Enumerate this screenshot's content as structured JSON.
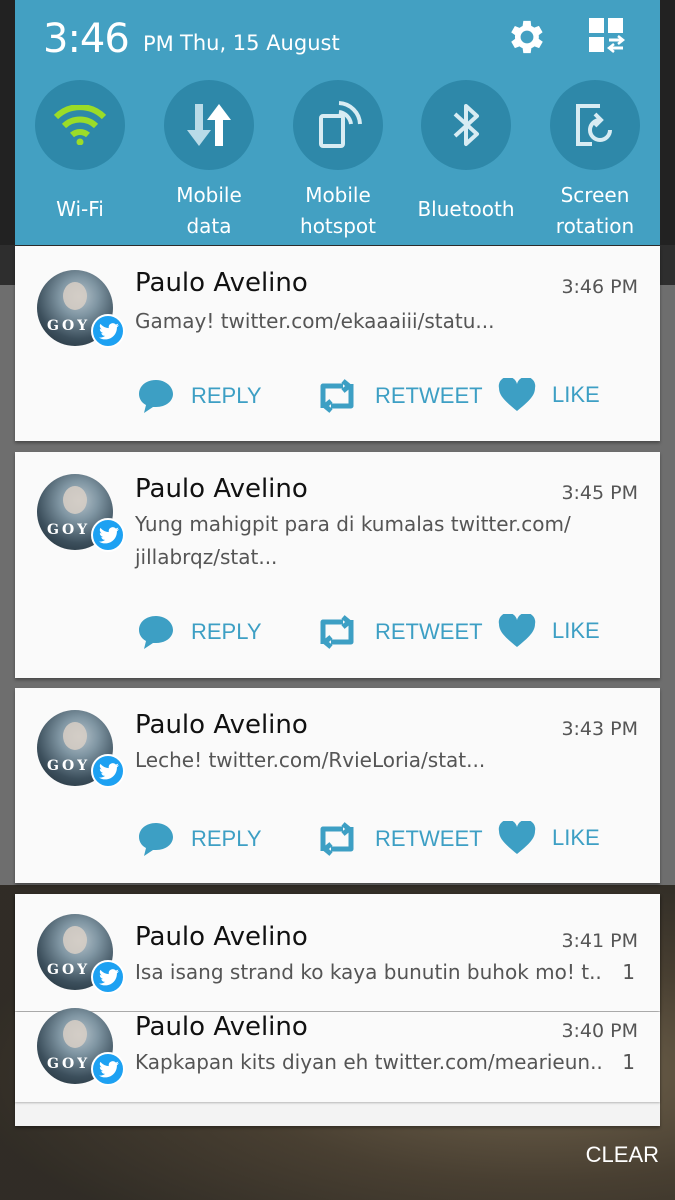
{
  "status": {
    "clock": "3:46",
    "ampm": "PM",
    "date": "Thu, 15 August"
  },
  "icons": {
    "settings": "gear-icon",
    "edit": "tile-grid-icon"
  },
  "colors": {
    "panel": "#43a0c2",
    "tile": "#2e88a9",
    "action": "#3d9fc4",
    "twitter": "#1da1f2",
    "wifi_on": "#9bdc28"
  },
  "tiles": [
    {
      "label": "Wi-Fi",
      "icon": "wifi-icon",
      "active": true
    },
    {
      "label1": "Mobile",
      "label2": "data",
      "icon": "mobile-data-icon"
    },
    {
      "label1": "Mobile",
      "label2": "hotspot",
      "icon": "hotspot-icon"
    },
    {
      "label": "Bluetooth",
      "icon": "bluetooth-icon"
    },
    {
      "label1": "Screen",
      "label2": "rotation",
      "icon": "screen-rotation-icon"
    }
  ],
  "actions": {
    "reply": "REPLY",
    "retweet": "RETWEET",
    "like": "LIKE"
  },
  "notifications": [
    {
      "name": "Paulo Avelino",
      "time": "3:46 PM",
      "text": "Gamay! twitter.com/ekaaaiii/statu..."
    },
    {
      "name": "Paulo Avelino",
      "time": "3:45 PM",
      "text1": "Yung mahigpit para di kumalas twitter.com/",
      "text2": "jillabrqz/stat..."
    },
    {
      "name": "Paulo Avelino",
      "time": "3:43 PM",
      "text": "Leche! twitter.com/RvieLoria/stat..."
    },
    {
      "name": "Paulo Avelino",
      "time": "3:41 PM",
      "text": "Isa isang strand ko kaya bunutin buhok mo! t..",
      "count": "1"
    },
    {
      "name": "Paulo Avelino",
      "time": "3:40 PM",
      "text": "Kapkapan kits diyan eh twitter.com/mearieun..",
      "count": "1"
    }
  ],
  "avatar_text": "GOY",
  "clear_label": "CLEAR"
}
